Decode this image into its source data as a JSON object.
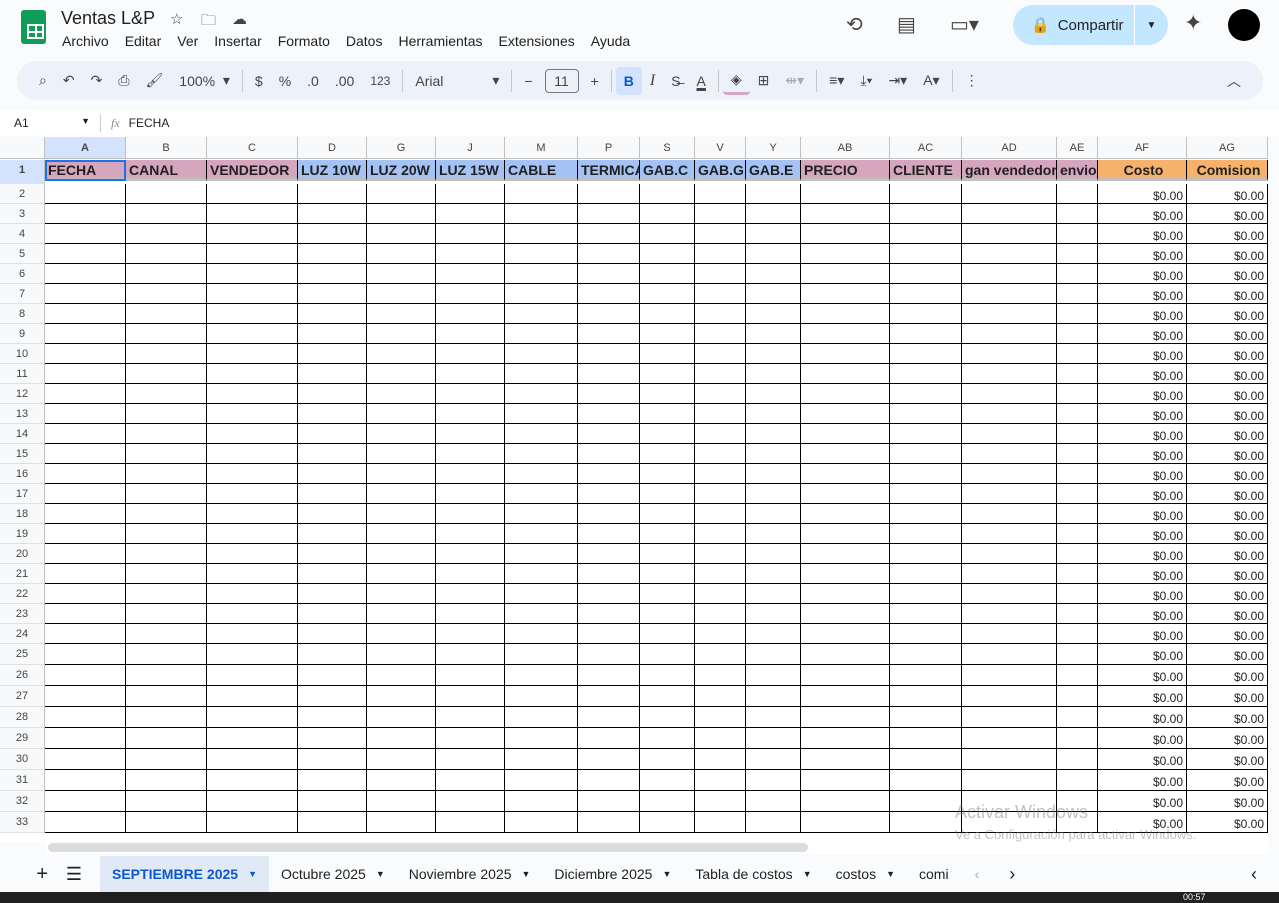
{
  "app": {
    "title": "Ventas L&P",
    "menu": [
      "Archivo",
      "Editar",
      "Ver",
      "Insertar",
      "Formato",
      "Datos",
      "Herramientas",
      "Extensiones",
      "Ayuda"
    ],
    "share_label": "Compartir"
  },
  "toolbar": {
    "zoom": "100%",
    "currency": "$",
    "percent": "%",
    "dec_decrease": ".0",
    "dec_increase": ".00",
    "number_format": "123",
    "font": "Arial",
    "font_size": "11",
    "bold": "B",
    "italic": "I"
  },
  "formula_bar": {
    "cell_ref": "A1",
    "fx": "fx",
    "content": "FECHA"
  },
  "columns": [
    {
      "letter": "A",
      "header": "FECHA",
      "color": "#d5a6bd"
    },
    {
      "letter": "B",
      "header": "CANAL",
      "color": "#d5a6bd"
    },
    {
      "letter": "C",
      "header": "VENDEDOR",
      "color": "#d5a6bd"
    },
    {
      "letter": "D",
      "header": "LUZ 10W",
      "color": "#a4c2f4"
    },
    {
      "letter": "G",
      "header": "LUZ 20W",
      "color": "#a4c2f4"
    },
    {
      "letter": "J",
      "header": "LUZ 15W",
      "color": "#a4c2f4"
    },
    {
      "letter": "M",
      "header": "CABLE",
      "color": "#a4c2f4"
    },
    {
      "letter": "P",
      "header": "TERMICA",
      "color": "#a4c2f4"
    },
    {
      "letter": "S",
      "header": "GAB.C",
      "color": "#a4c2f4"
    },
    {
      "letter": "V",
      "header": "GAB.G",
      "color": "#a4c2f4"
    },
    {
      "letter": "Y",
      "header": "GAB.E",
      "color": "#a4c2f4"
    },
    {
      "letter": "AB",
      "header": "PRECIO",
      "color": "#d5a6bd"
    },
    {
      "letter": "AC",
      "header": "CLIENTE",
      "color": "#d5a6bd"
    },
    {
      "letter": "AD",
      "header": "gan vendedor",
      "color": "#d5a6bd"
    },
    {
      "letter": "AE",
      "header": "envio",
      "color": "#d5a6bd"
    },
    {
      "letter": "AF",
      "header": "Costo",
      "color": "#f6b26b"
    },
    {
      "letter": "AG",
      "header": "Comision",
      "color": "#f6b26b"
    }
  ],
  "rows": {
    "first": 2,
    "last": 33,
    "costo": "$0.00",
    "comision": "$0.00"
  },
  "sheet_tabs": [
    "SEPTIEMBRE 2025",
    "Octubre 2025",
    "Noviembre 2025",
    "Diciembre 2025",
    "Tabla de costos",
    "costos",
    "comi"
  ],
  "watermark": {
    "title": "Activar Windows",
    "subtitle": "Ve a Configuración para activar Windows."
  },
  "taskbar": {
    "time": "00:57"
  }
}
